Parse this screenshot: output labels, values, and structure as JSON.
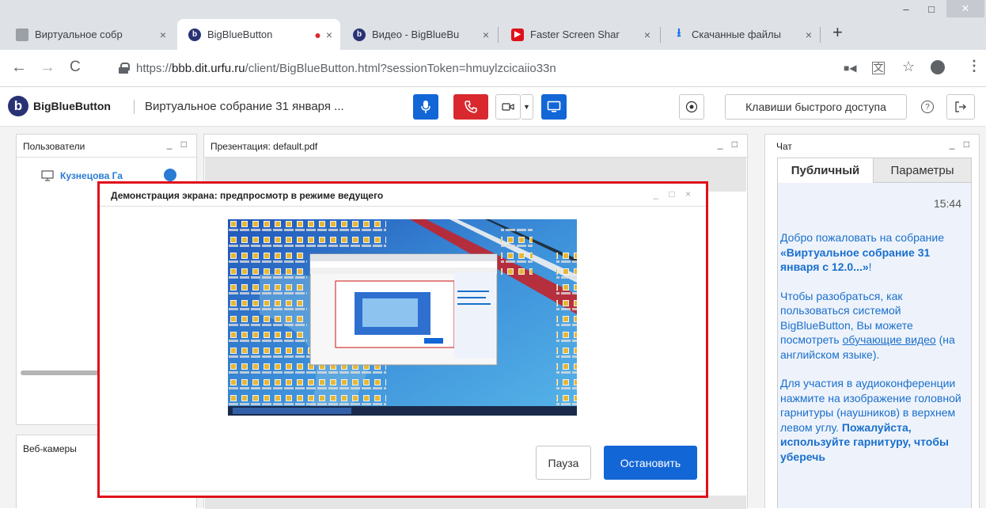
{
  "browser": {
    "tabs": [
      {
        "title": "Виртуальное собр",
        "icon": "page-icon",
        "close": "×"
      },
      {
        "title": "BigBlueButton",
        "icon": "bbb-logo-icon",
        "close": "×",
        "recording": "●"
      },
      {
        "title": "Видео - BigBlueBu",
        "icon": "bbb-logo-icon",
        "close": "×"
      },
      {
        "title": "Faster Screen Shar",
        "icon": "youtube-icon",
        "close": "×"
      },
      {
        "title": "Скачанные файлы",
        "icon": "download-icon",
        "close": "×"
      }
    ],
    "new_tab": "+",
    "window_controls": {
      "minimize": "–",
      "maximize": "□",
      "close": "✕"
    },
    "url_prefix": "https://",
    "url_domain": "bbb.dit.urfu.ru",
    "url_path": "/client/BigBlueButton.html?sessionToken=hmuylzcicaiio33n"
  },
  "bbb": {
    "brand": "BigBlueButton",
    "meeting_title": "Виртуальное собрание 31 января ...",
    "shortcuts_label": "Клавиши быстрого доступа",
    "help": "?",
    "accent": "#1366d6",
    "danger": "#d9292e"
  },
  "users_panel": {
    "title": "Пользователи",
    "controls": "_ □",
    "user_name": "Кузнецова Га"
  },
  "presentation_panel": {
    "title": "Презентация: default.pdf",
    "controls": "_ □"
  },
  "webcams_panel": {
    "title": "Веб-камеры"
  },
  "chat_panel": {
    "title": "Чат",
    "controls": "_ □",
    "tab_public": "Публичный",
    "tab_options": "Параметры",
    "time": "15:44",
    "welcome_prefix": "Добро пожаловать на собрание ",
    "welcome_bold": "«Виртуальное собрание 31 января  с 12.0...»",
    "welcome_suffix": "!",
    "help_text_1": "Чтобы разобраться, как пользоваться системой BigBlueButton, Вы можете посмотреть ",
    "help_link": "обучающие видео",
    "help_text_2": " (на английском языке).",
    "audio_text": "Для участия в аудиоконференции нажмите на изображение головной гарнитуры (наушников) в верхнем левом углу.",
    "audio_bold": "Пожалуйста, используйте гарнитуру, чтобы уберечь"
  },
  "dialog": {
    "title": "Демонстрация экрана: предпросмотр в режиме ведущего",
    "controls": "_ □ ×",
    "pause_label": "Пауза",
    "stop_label": "Остановить"
  }
}
